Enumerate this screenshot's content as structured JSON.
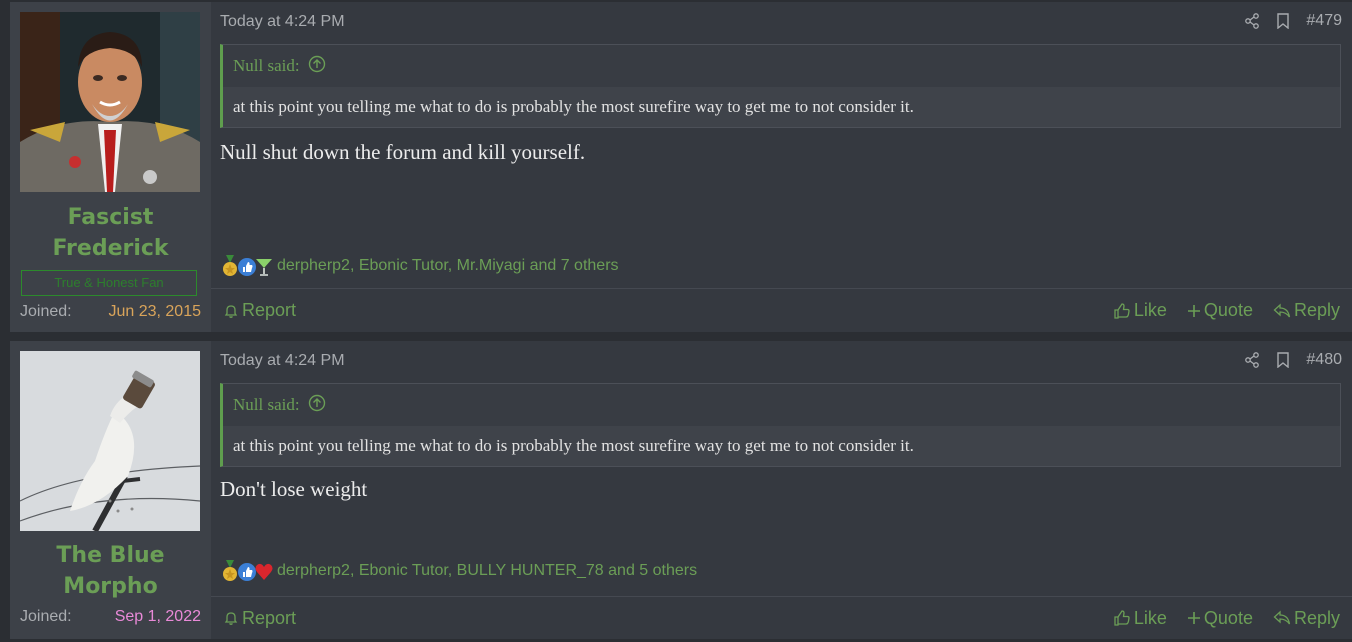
{
  "posts": [
    {
      "author": {
        "name_line1": "Fascist",
        "name_line2": "Frederick",
        "title": "True & Honest Fan",
        "joined_label": "Joined:",
        "joined_date": "Jun 23, 2015"
      },
      "date": "Today at 4:24 PM",
      "number": "#479",
      "quote": {
        "author": "Null said:",
        "text": "at this point you telling me what to do is probably the most surefire way to get me to not consider it."
      },
      "message": "Null shut down the forum and kill yourself.",
      "reactions_text": "derpherp2, Ebonic Tutor, Mr.Miyagi and 7 others",
      "footer": {
        "report": "Report",
        "like": "Like",
        "quote": "Quote",
        "reply": "Reply"
      }
    },
    {
      "author": {
        "name_line1": "The Blue",
        "name_line2": "Morpho",
        "joined_label": "Joined:",
        "joined_date": "Sep 1, 2022"
      },
      "date": "Today at 4:24 PM",
      "number": "#480",
      "quote": {
        "author": "Null said:",
        "text": "at this point you telling me what to do is probably the most surefire way to get me to not consider it."
      },
      "message": "Don't lose weight",
      "reactions_text": "derpherp2, Ebonic Tutor, BULLY HUNTER_78 and 5 others",
      "footer": {
        "report": "Report",
        "like": "Like",
        "quote": "Quote",
        "reply": "Reply"
      }
    }
  ],
  "colors": {
    "accent": "#6b9e56",
    "background": "#2b2e33",
    "post_bg": "#353940",
    "user_bg": "#3d4148"
  },
  "icons": [
    "share-icon",
    "bookmark-icon",
    "up-arrow-circle-icon",
    "bell-icon",
    "thumbs-up-icon",
    "plus-icon",
    "reply-arrow-icon",
    "medal-reaction-icon",
    "like-reaction-icon",
    "cocktail-reaction-icon",
    "heart-reaction-icon"
  ]
}
